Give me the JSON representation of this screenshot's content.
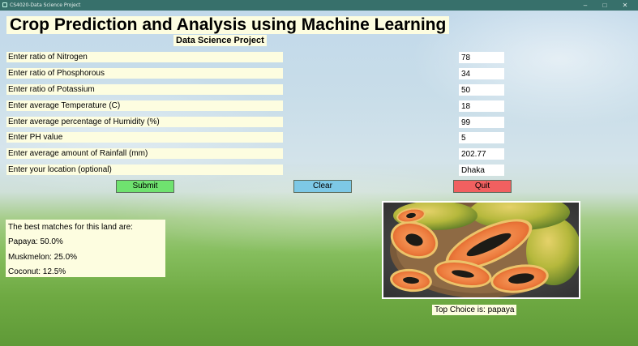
{
  "window": {
    "title": "CS4020-Data Science Project",
    "minimize_glyph": "–",
    "maximize_glyph": "□",
    "close_glyph": "✕"
  },
  "header": {
    "title": "Crop Prediction and Analysis using Machine Learning",
    "subtitle": "Data Science Project"
  },
  "form": {
    "nitrogen": {
      "label": "Enter ratio of Nitrogen",
      "value": "78"
    },
    "phosphorous": {
      "label": "Enter ratio of Phosphorous",
      "value": "34"
    },
    "potassium": {
      "label": "Enter ratio of Potassium",
      "value": "50"
    },
    "temperature": {
      "label": "Enter average Temperature (C)",
      "value": "18"
    },
    "humidity": {
      "label": "Enter average percentage of Humidity (%)",
      "value": "99"
    },
    "ph": {
      "label": "Enter PH value",
      "value": "5"
    },
    "rainfall": {
      "label": "Enter average amount of Rainfall (mm)",
      "value": "202.77"
    },
    "location": {
      "label": "Enter your location (optional)",
      "value": "Dhaka"
    }
  },
  "buttons": {
    "submit": "Submit",
    "clear": "Clear",
    "quit": "Quit"
  },
  "colors": {
    "submit": "#6fe26f",
    "clear": "#7dc8e6",
    "quit": "#f16060",
    "label_bg": "#fdfde0"
  },
  "results": {
    "heading": "The best matches for this land are:",
    "matches": [
      "Papaya: 50.0%",
      "Muskmelon: 25.0%",
      "Coconut: 12.5%"
    ]
  },
  "top_choice": {
    "caption": "Top Choice is: papaya",
    "image_subject": "papaya"
  }
}
